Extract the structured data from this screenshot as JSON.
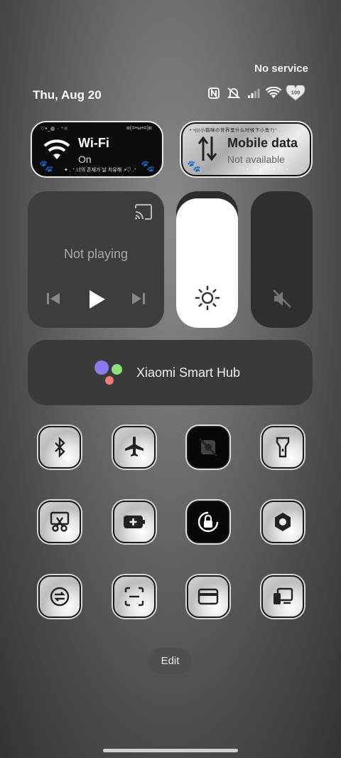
{
  "status_bar": {
    "carrier": "No service",
    "date": "Thu, Aug 20",
    "battery": "100",
    "icons": [
      "nfc-icon",
      "silent-icon",
      "signal-icon",
      "wifi-icon",
      "battery-heart-icon"
    ]
  },
  "wifi_tile": {
    "title": "Wi-Fi",
    "status": "On",
    "deco_top": "♡•_◍ · ⁺✧",
    "deco_top_right": "o(=•ω•=)o",
    "deco_bottom": "✦ . ⁺.너의 존재가 날 치유해 .•♡ .⁺"
  },
  "mobile_tile": {
    "title": "Mobile data",
    "status": "Not available",
    "deco_top": "• •||(小猫咪の世界里什么时候下小鱼?)⁺ .",
    "deco_bottom": "♡ ⋆ ♡ ⋆ ♡ ⋆ ♡ ⋆"
  },
  "media": {
    "status": "Not playing"
  },
  "sliders": {
    "brightness_level": 0.95,
    "volume_muted": true
  },
  "hub": {
    "label": "Xiaomi Smart Hub",
    "colors": [
      "#8a7cf0",
      "#8ee07a",
      "#f07a7a"
    ]
  },
  "toggles": [
    {
      "name": "bluetooth",
      "active": false
    },
    {
      "name": "airplane-mode",
      "active": false
    },
    {
      "name": "camera-disabled",
      "active": true
    },
    {
      "name": "flashlight",
      "active": false
    },
    {
      "name": "screenshot",
      "active": false
    },
    {
      "name": "battery-saver",
      "active": false
    },
    {
      "name": "rotation-lock",
      "active": true
    },
    {
      "name": "settings",
      "active": false
    },
    {
      "name": "sync",
      "active": false
    },
    {
      "name": "scanner",
      "active": false
    },
    {
      "name": "card",
      "active": false
    },
    {
      "name": "cast-device",
      "active": false
    }
  ],
  "edit_label": "Edit"
}
